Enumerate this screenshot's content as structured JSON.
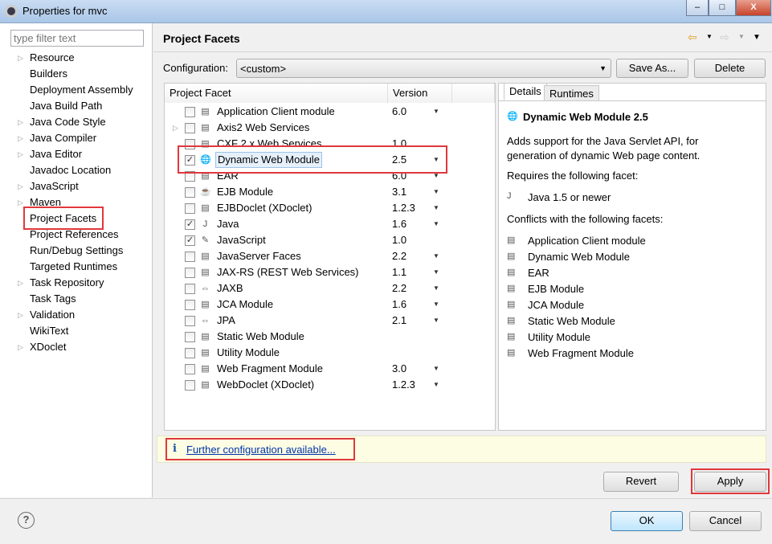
{
  "window": {
    "title": "Properties for mvc",
    "controls": [
      "minimize",
      "maximize",
      "close"
    ]
  },
  "sidebar": {
    "filter_placeholder": "type filter text",
    "items": [
      {
        "label": "Resource",
        "expandable": true
      },
      {
        "label": "Builders",
        "expandable": false
      },
      {
        "label": "Deployment Assembly",
        "expandable": false
      },
      {
        "label": "Java Build Path",
        "expandable": false
      },
      {
        "label": "Java Code Style",
        "expandable": true
      },
      {
        "label": "Java Compiler",
        "expandable": true
      },
      {
        "label": "Java Editor",
        "expandable": true
      },
      {
        "label": "Javadoc Location",
        "expandable": false
      },
      {
        "label": "JavaScript",
        "expandable": true
      },
      {
        "label": "Maven",
        "expandable": true
      },
      {
        "label": "Project Facets",
        "expandable": false,
        "selected": true
      },
      {
        "label": "Project References",
        "expandable": false
      },
      {
        "label": "Run/Debug Settings",
        "expandable": false
      },
      {
        "label": "Targeted Runtimes",
        "expandable": false
      },
      {
        "label": "Task Repository",
        "expandable": true
      },
      {
        "label": "Task Tags",
        "expandable": false
      },
      {
        "label": "Validation",
        "expandable": true
      },
      {
        "label": "WikiText",
        "expandable": false
      },
      {
        "label": "XDoclet",
        "expandable": true
      }
    ]
  },
  "header": {
    "title": "Project Facets",
    "back_icon": "back-arrow-icon",
    "forward_icon": "forward-arrow-icon",
    "menu_icon": "view-menu-icon"
  },
  "configuration": {
    "label": "Configuration:",
    "value": "<custom>",
    "save_as": "Save As...",
    "delete": "Delete"
  },
  "facets_table": {
    "columns": [
      "Project Facet",
      "Version"
    ],
    "rows": [
      {
        "name": "Application Client module",
        "version": "6.0",
        "checked": false,
        "dropdown": true,
        "icon": "page-icon"
      },
      {
        "name": "Axis2 Web Services",
        "version": "",
        "checked": false,
        "dropdown": false,
        "icon": "page-icon",
        "expandable": true
      },
      {
        "name": "CXF 2.x Web Services",
        "version": "1.0",
        "checked": false,
        "dropdown": false,
        "icon": "page-icon"
      },
      {
        "name": "Dynamic Web Module",
        "version": "2.5",
        "checked": true,
        "dropdown": true,
        "icon": "web-module-icon",
        "selected": true
      },
      {
        "name": "EAR",
        "version": "6.0",
        "checked": false,
        "dropdown": true,
        "icon": "page-icon"
      },
      {
        "name": "EJB Module",
        "version": "3.1",
        "checked": false,
        "dropdown": true,
        "icon": "ejb-bean-icon"
      },
      {
        "name": "EJBDoclet (XDoclet)",
        "version": "1.2.3",
        "checked": false,
        "dropdown": true,
        "icon": "page-icon"
      },
      {
        "name": "Java",
        "version": "1.6",
        "checked": true,
        "dropdown": true,
        "icon": "java-icon"
      },
      {
        "name": "JavaScript",
        "version": "1.0",
        "checked": true,
        "dropdown": false,
        "icon": "javascript-icon"
      },
      {
        "name": "JavaServer Faces",
        "version": "2.2",
        "checked": false,
        "dropdown": true,
        "icon": "page-icon"
      },
      {
        "name": "JAX-RS (REST Web Services)",
        "version": "1.1",
        "checked": false,
        "dropdown": true,
        "icon": "page-icon"
      },
      {
        "name": "JAXB",
        "version": "2.2",
        "checked": false,
        "dropdown": true,
        "icon": "jaxb-arrows-icon"
      },
      {
        "name": "JCA Module",
        "version": "1.6",
        "checked": false,
        "dropdown": true,
        "icon": "page-icon"
      },
      {
        "name": "JPA",
        "version": "2.1",
        "checked": false,
        "dropdown": true,
        "icon": "jpa-arrows-icon"
      },
      {
        "name": "Static Web Module",
        "version": "",
        "checked": false,
        "dropdown": false,
        "icon": "page-icon"
      },
      {
        "name": "Utility Module",
        "version": "",
        "checked": false,
        "dropdown": false,
        "icon": "page-icon"
      },
      {
        "name": "Web Fragment Module",
        "version": "3.0",
        "checked": false,
        "dropdown": true,
        "icon": "page-icon"
      },
      {
        "name": "WebDoclet (XDoclet)",
        "version": "1.2.3",
        "checked": false,
        "dropdown": true,
        "icon": "page-icon"
      }
    ]
  },
  "details": {
    "tabs": [
      "Details",
      "Runtimes"
    ],
    "title": "Dynamic Web Module 2.5",
    "description": "Adds support for the Java Servlet API, for generation of dynamic Web page content.",
    "requires_label": "Requires the following facet:",
    "requires": [
      "Java 1.5 or newer"
    ],
    "conflicts_label": "Conflicts with the following facets:",
    "conflicts": [
      "Application Client module",
      "Dynamic Web Module",
      "EAR",
      "EJB Module",
      "JCA Module",
      "Static Web Module",
      "Utility Module",
      "Web Fragment Module"
    ]
  },
  "info": {
    "icon": "info-icon",
    "link": "Further configuration available..."
  },
  "buttons": {
    "revert": "Revert",
    "apply": "Apply",
    "ok": "OK",
    "cancel": "Cancel",
    "help_icon": "help-icon"
  },
  "colors": {
    "highlight": "#e0383c",
    "link": "#0033aa",
    "info_bg": "#fdfde4"
  }
}
